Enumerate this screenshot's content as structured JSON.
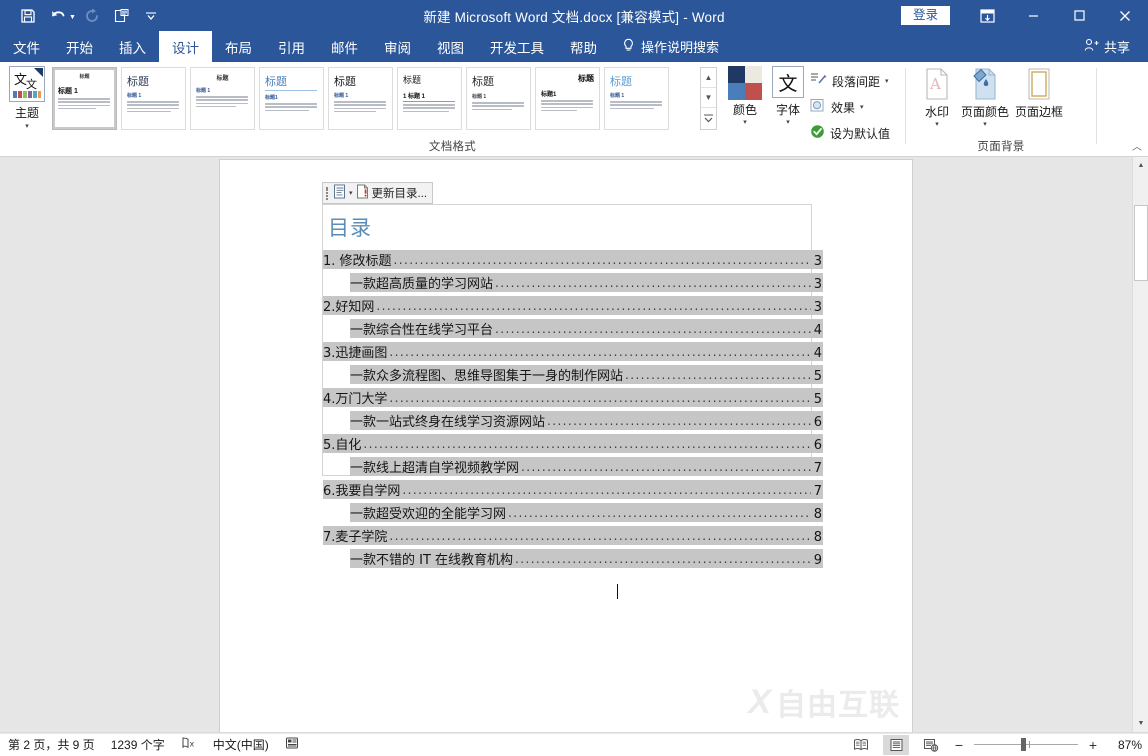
{
  "titlebar": {
    "document_title": "新建 Microsoft Word 文档.docx [兼容模式]  -  Word",
    "signin_label": "登录",
    "quick_access": [
      {
        "name": "save-icon",
        "tooltip": "保存"
      },
      {
        "name": "undo-icon",
        "tooltip": "撤消"
      },
      {
        "name": "redo-icon",
        "tooltip": "恢复"
      },
      {
        "name": "quick-print-icon",
        "tooltip": "快速打印"
      },
      {
        "name": "customize-qat-icon",
        "tooltip": "自定义快速访问工具栏"
      }
    ],
    "window_buttons": [
      {
        "name": "ribbon-display-options-icon",
        "glyph": "▤"
      },
      {
        "name": "minimize-button",
        "glyph": "—"
      },
      {
        "name": "maximize-button",
        "glyph": "▢"
      },
      {
        "name": "close-button",
        "glyph": "✕"
      }
    ]
  },
  "tabs": [
    {
      "label": "文件",
      "active": false
    },
    {
      "label": "开始",
      "active": false
    },
    {
      "label": "插入",
      "active": false
    },
    {
      "label": "设计",
      "active": true
    },
    {
      "label": "布局",
      "active": false
    },
    {
      "label": "引用",
      "active": false
    },
    {
      "label": "邮件",
      "active": false
    },
    {
      "label": "审阅",
      "active": false
    },
    {
      "label": "视图",
      "active": false
    },
    {
      "label": "开发工具",
      "active": false
    },
    {
      "label": "帮助",
      "active": false
    }
  ],
  "tellme": {
    "label": "操作说明搜索",
    "icon": "lightbulb-icon"
  },
  "share": {
    "label": "共享",
    "icon": "person-add-icon"
  },
  "ribbon": {
    "groups": [
      {
        "name": "文档格式",
        "label": "文档格式"
      },
      {
        "name": "页面背景",
        "label": "页面背景"
      }
    ],
    "themes": {
      "label": "主题",
      "caret": "▾"
    },
    "gallery": {
      "items": [
        {
          "title": "标题",
          "heading": "标题 1",
          "style": "boxed",
          "selected": true
        },
        {
          "title": "标题",
          "heading": "标题 1",
          "style": "left-large",
          "selected": false
        },
        {
          "title": "标题",
          "heading": "标题 1",
          "style": "right-small",
          "selected": false
        },
        {
          "title": "标题",
          "heading": "标题1",
          "style": "blue-underline",
          "selected": false
        },
        {
          "title": "标题",
          "heading": "标题 1",
          "style": "serif-large",
          "selected": false
        },
        {
          "title": "标题",
          "heading": "1 标题 1",
          "style": "numbered-rule",
          "selected": false
        },
        {
          "title": "标题",
          "heading": "标题 1",
          "style": "light-serif",
          "selected": false
        },
        {
          "title": "标题",
          "heading": "标题1",
          "style": "bold-right",
          "selected": false
        },
        {
          "title": "标题",
          "heading": "标题 1",
          "style": "blue-title",
          "selected": false
        }
      ],
      "scroll_up": "▲",
      "scroll_down": "▼",
      "more": "▔"
    },
    "colors_button": {
      "label": "颜色",
      "caret": "▾",
      "swatch": [
        "#1f3864",
        "#ece9e0",
        "#4a7ebb",
        "#c0504d"
      ]
    },
    "fonts_button": {
      "label": "字体",
      "caret": "▾",
      "glyph": "文"
    },
    "small_commands": [
      {
        "label": "段落间距",
        "icon": "paragraph-spacing-icon",
        "caret": "▾"
      },
      {
        "label": "效果",
        "icon": "effects-icon",
        "caret": "▾"
      },
      {
        "label": "设为默认值",
        "icon": "set-default-icon",
        "caret": ""
      }
    ],
    "page_background": [
      {
        "label": "水印",
        "icon": "watermark-icon",
        "caret": "▾"
      },
      {
        "label": "页面颜色",
        "icon": "page-color-icon",
        "caret": "▾"
      },
      {
        "label": "页面边框",
        "icon": "page-borders-icon",
        "caret": ""
      }
    ],
    "collapse_caret": "︿"
  },
  "document": {
    "content_control": {
      "toolbar_label": "更新目录...",
      "handle_icon": "content-control-handle-icon",
      "dropdown_caret": "▾",
      "update_icon": "update-toc-icon"
    },
    "toc_heading": "目录",
    "toc_entries": [
      {
        "level": 1,
        "text": "1. 修改标题",
        "page": "3"
      },
      {
        "level": 2,
        "text": "一款超高质量的学习网站",
        "page": "3"
      },
      {
        "level": 1,
        "text": "2.好知网",
        "page": "3"
      },
      {
        "level": 2,
        "text": "一款综合性在线学习平台",
        "page": "4"
      },
      {
        "level": 1,
        "text": "3.迅捷画图",
        "page": "4"
      },
      {
        "level": 2,
        "text": "一款众多流程图、思维导图集于一身的制作网站",
        "page": "5"
      },
      {
        "level": 1,
        "text": "4.万门大学",
        "page": "5"
      },
      {
        "level": 2,
        "text": "一款一站式终身在线学习资源网站",
        "page": "6"
      },
      {
        "level": 1,
        "text": "5.自化",
        "page": "6"
      },
      {
        "level": 2,
        "text": "一款线上超清自学视频教学网",
        "page": "7"
      },
      {
        "level": 1,
        "text": "6.我要自学网",
        "page": "7"
      },
      {
        "level": 2,
        "text": "一款超受欢迎的全能学习网",
        "page": "8"
      },
      {
        "level": 1,
        "text": "7.麦子学院",
        "page": "8"
      },
      {
        "level": 2,
        "text": "一款不错的 IT 在线教育机构",
        "page": "9"
      }
    ],
    "watermark": {
      "logo": "X",
      "text": "自由互联"
    }
  },
  "statusbar": {
    "page_info": "第 2 页，共 9 页",
    "word_count": "1239 个字",
    "proofing_icon": "proofing-errors-icon",
    "language": "中文(中国)",
    "accessibility_icon": "accessibility-icon",
    "view_buttons": [
      {
        "name": "read-mode-icon",
        "active": false
      },
      {
        "name": "print-layout-icon",
        "active": true
      },
      {
        "name": "web-layout-icon",
        "active": false
      }
    ],
    "zoom_out": "−",
    "zoom_in": "+",
    "zoom_level": "87%"
  }
}
